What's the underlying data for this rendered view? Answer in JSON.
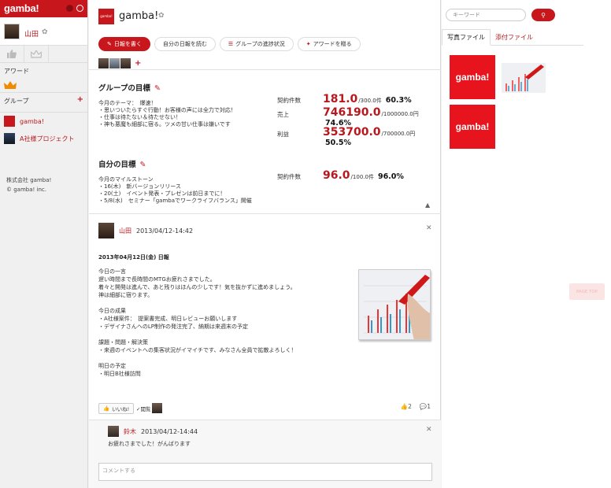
{
  "sidebar": {
    "logo": "gamba!",
    "user_name": "山田",
    "award_label": "アワード",
    "group_label": "グループ",
    "groups": [
      "gamba!",
      "A社様プロジェクト"
    ],
    "company_name": "株式会社 gamba!",
    "copyright": "© gamba! inc."
  },
  "header": {
    "logo_text": "gamba!",
    "title": "gamba!"
  },
  "tabs": [
    "日報を書く",
    "自分の日報を読む",
    "グループの進捗状況",
    "アワードを贈る"
  ],
  "group_goal": {
    "title": "グループの目標",
    "text": "今月のテーマ：　爆速！\n・思いついたらすぐ行動！お客様の声には全力で対応！\n・仕事は待たない＆待たせない！\n・神も悪魔も細部に宿る。ツメの甘い仕事は嫌いです",
    "metrics": [
      {
        "label": "契約件数",
        "value": "181.0",
        "target": "/300.0件",
        "pct": "60.3%"
      },
      {
        "label": "売上",
        "value": "746190.0",
        "target": "/1000000.0円",
        "pct": "74.6%"
      },
      {
        "label": "利益",
        "value": "353700.0",
        "target": "/700000.0円",
        "pct": "50.5%"
      }
    ]
  },
  "my_goal": {
    "title": "自分の目標",
    "text": "今月のマイルストーン\n・16(木)　新バージョンリリース\n・20(土)　イベント発表・プレゼンは前日までに！\n・5/8(水)　セミナー「gambaでワークライフバランス」開催",
    "metric": {
      "label": "契約件数",
      "value": "96.0",
      "target": "/100.0件",
      "pct": "96.0%"
    }
  },
  "post": {
    "author": "山田",
    "datetime": "2013/04/12-14:42",
    "title": "2013年04月12日(金) 日報",
    "body": "今日の一言\n遅い時間まで長時間のMTGお疲れさまでした。\n着々と開発は進んで、あと残りはほんの少しです！気を抜かずに進めましょう。\n神は細部に宿ります。\n\n今日の成果\n・A社様案件：　提案書完成、明日レビューお願いします\n・デザイナさんへのLP制作の発注完了、納期は来週末の予定\n\n課題・問題・解決策\n・来週のイベントへの集客状況がイマイチです、みなさん全員で拡散よろしく！\n\n明日の予定\n・明日B社様訪問",
    "like_label": "いいね!",
    "read_label": "✓閲覧",
    "like_count": "2",
    "comment_count": "1"
  },
  "comment": {
    "author": "鈴木",
    "datetime": "2013/04/12-14:44",
    "text": "お疲れさまでした！がんばります",
    "placeholder": "コメントする"
  },
  "right_panel": {
    "search_placeholder": "キーワード",
    "tabs": [
      "写真ファイル",
      "添付ファイル"
    ],
    "thumb_text": "gamba!"
  },
  "page_top": "PAGE TOP"
}
